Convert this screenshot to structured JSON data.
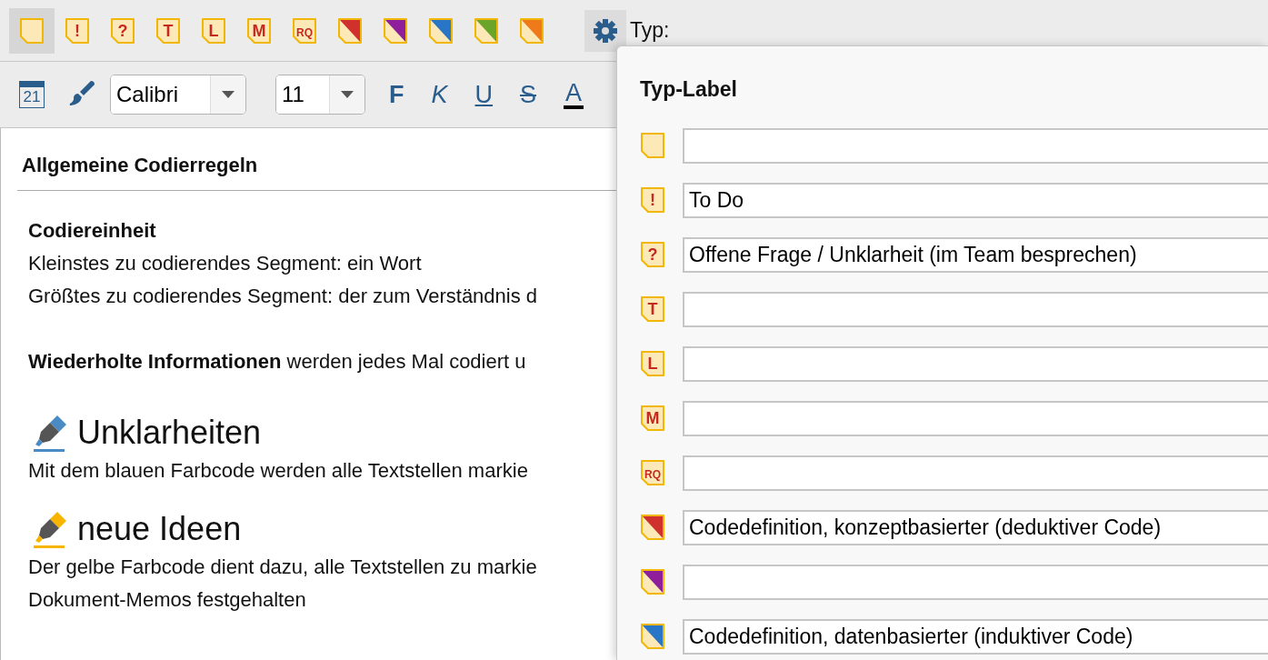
{
  "memo_toolbar": {
    "types": [
      {
        "kind": "blank",
        "selected": true
      },
      {
        "kind": "symbol",
        "symbol": "!",
        "selected": false
      },
      {
        "kind": "symbol",
        "symbol": "?",
        "selected": false
      },
      {
        "kind": "symbol",
        "symbol": "T",
        "selected": false
      },
      {
        "kind": "symbol",
        "symbol": "L",
        "selected": false
      },
      {
        "kind": "symbol",
        "symbol": "M",
        "selected": false
      },
      {
        "kind": "symbol",
        "symbol": "RQ",
        "selected": false
      },
      {
        "kind": "color",
        "color": "#d0312d",
        "selected": false
      },
      {
        "kind": "color",
        "color": "#8e1e9a",
        "selected": false
      },
      {
        "kind": "color",
        "color": "#2a76c6",
        "selected": false
      },
      {
        "kind": "color",
        "color": "#6aa52a",
        "selected": false
      },
      {
        "kind": "color",
        "color": "#ee7a1a",
        "selected": false
      }
    ],
    "type_label": "Typ:"
  },
  "format_toolbar": {
    "calendar_day": "21",
    "font": "Calibri",
    "size": "11",
    "styles": [
      {
        "kind": "bold",
        "glyph": "F"
      },
      {
        "kind": "italic",
        "glyph": "K"
      },
      {
        "kind": "underline",
        "glyph": "U"
      },
      {
        "kind": "strike",
        "glyph": "S"
      },
      {
        "kind": "color",
        "glyph": "A"
      }
    ]
  },
  "document": {
    "title": "Allgemeine Codierregeln",
    "blocks": [
      {
        "kind": "paragraph",
        "lines": [
          {
            "text": "Codiereinheit",
            "bold": true
          },
          {
            "text": "Kleinstes zu codierendes Segment: ein Wort",
            "bold": false
          },
          {
            "text": "Größtes zu codierendes Segment: der zum Verständnis d",
            "bold": false
          }
        ]
      },
      {
        "kind": "paragraph",
        "lines": [
          {
            "text": "**Wiederholte Informationen** werden jedes Mal codiert u",
            "bold": false
          }
        ]
      },
      {
        "kind": "section",
        "heading": "Unklarheiten",
        "color": "#4a8bc4",
        "lines": [
          {
            "text": "Mit dem blauen Farbcode werden alle Textstellen markie",
            "bold": false
          }
        ]
      },
      {
        "kind": "section",
        "heading": "neue Ideen",
        "color": "#f7b500",
        "lines": [
          {
            "text": "Der gelbe Farbcode dient dazu, alle Textstellen zu markie",
            "bold": false
          },
          {
            "text": "Dokument-Memos festgehalten",
            "bold": false
          }
        ]
      }
    ]
  },
  "popup": {
    "title": "Typ-Label",
    "rows": [
      {
        "kind": "blank"
      },
      {
        "kind": "symbol",
        "symbol": "!",
        "value": "To Do"
      },
      {
        "kind": "symbol",
        "symbol": "?",
        "value": "Offene Frage / Unklarheit (im Team besprechen)"
      },
      {
        "kind": "symbol",
        "symbol": "T"
      },
      {
        "kind": "symbol",
        "symbol": "L"
      },
      {
        "kind": "symbol",
        "symbol": "M"
      },
      {
        "kind": "symbol",
        "symbol": "RQ"
      },
      {
        "kind": "color",
        "color": "#d0312d",
        "value": "Codedefinition, konzeptbasierter (deduktiver Code)"
      },
      {
        "kind": "color",
        "color": "#8e1e9a"
      },
      {
        "kind": "color",
        "color": "#2a76c6",
        "value": "Codedefinition, datenbasierter (induktiver Code)"
      }
    ]
  }
}
